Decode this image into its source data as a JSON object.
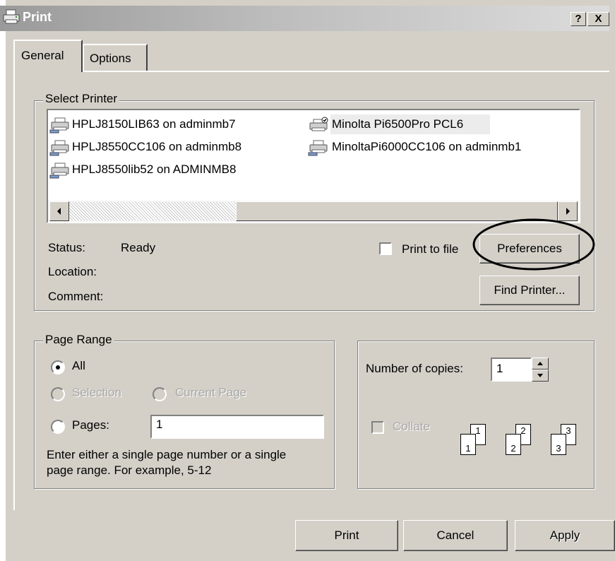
{
  "window": {
    "title": "Print",
    "help_label": "?",
    "close_label": "X"
  },
  "tabs": [
    {
      "label": "General",
      "selected": true
    },
    {
      "label": "Options",
      "selected": false
    }
  ],
  "select_printer": {
    "legend": "Select Printer",
    "printers": [
      {
        "name": "HPLJ8150LIB63 on adminmb7",
        "icon": "network-printer-icon"
      },
      {
        "name": "HPLJ8550CC106 on adminmb8",
        "icon": "network-printer-icon"
      },
      {
        "name": "HPLJ8550lib52 on ADMINMB8",
        "icon": "network-printer-icon"
      },
      {
        "name": "Minolta Pi6500Pro PCL6",
        "icon": "default-printer-icon",
        "selected": true
      },
      {
        "name": "MinoltaPi6000CC106 on adminmb1",
        "icon": "network-printer-icon"
      }
    ],
    "status_label": "Status:",
    "status_value": "Ready",
    "location_label": "Location:",
    "comment_label": "Comment:",
    "print_to_file_label": "Print to file",
    "print_to_file_checked": false,
    "preferences_label": "Preferences",
    "find_printer_label": "Find Printer..."
  },
  "page_range": {
    "legend": "Page Range",
    "all_label": "All",
    "selection_label": "Selection",
    "current_page_label": "Current Page",
    "pages_label": "Pages:",
    "pages_value": "1",
    "selected_option": "All",
    "hint_line1": "Enter either a single page number or a single",
    "hint_line2": "page range.  For example, 5-12"
  },
  "copies": {
    "number_label": "Number of copies:",
    "number_value": "1",
    "collate_label": "Collate",
    "collate_checked": false,
    "page_numbers": [
      "1",
      "2",
      "3"
    ]
  },
  "footer": {
    "print_label": "Print",
    "cancel_label": "Cancel",
    "apply_label": "Apply"
  },
  "colors": {
    "dialog_face": "#d4d0c8",
    "annotation_ellipse": "#000000"
  }
}
